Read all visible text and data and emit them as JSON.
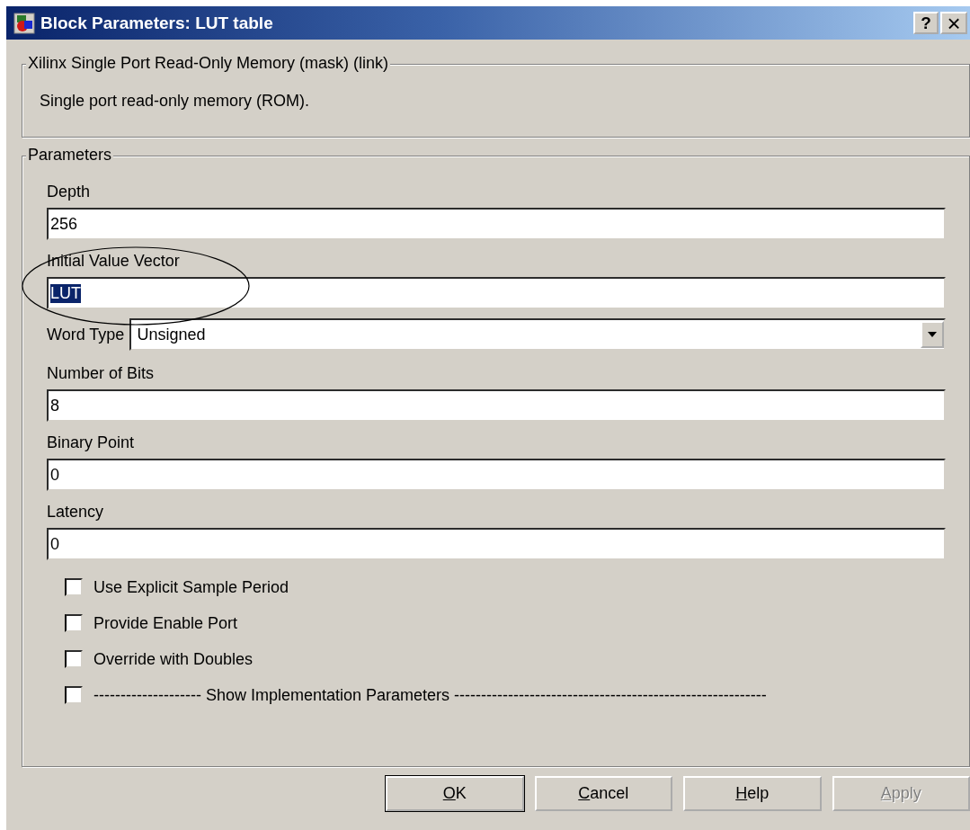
{
  "window": {
    "title": "Block Parameters: LUT table",
    "title_buttons": [
      {
        "kind": "help",
        "label": "?"
      },
      {
        "kind": "close",
        "label": "×"
      }
    ]
  },
  "description_group": {
    "title": "Xilinx Single Port Read-Only Memory (mask) (link)",
    "text": "Single port read-only memory (ROM)."
  },
  "parameters": {
    "title": "Parameters",
    "fields": [
      {
        "kind": "text",
        "label": "Depth",
        "value": "256",
        "text_selected": false
      },
      {
        "kind": "text",
        "label": "Initial Value Vector",
        "value": "LUT",
        "text_selected": true
      },
      {
        "kind": "dropdown",
        "label": "Word Type",
        "value": "Unsigned"
      },
      {
        "kind": "text",
        "label": "Number of Bits",
        "value": "8",
        "text_selected": false
      },
      {
        "kind": "text",
        "label": "Binary Point",
        "value": "0",
        "text_selected": false
      },
      {
        "kind": "text",
        "label": "Latency",
        "value": "0",
        "text_selected": false
      }
    ],
    "checkboxes": [
      {
        "label": "Use Explicit Sample Period",
        "checked": false
      },
      {
        "label": "Provide Enable Port",
        "checked": false
      },
      {
        "label": "Override with Doubles",
        "checked": false
      },
      {
        "label": "-------------------- Show Implementation Parameters ----------------------------------------------------------",
        "checked": false
      }
    ]
  },
  "buttons": [
    {
      "label": "OK",
      "default": true,
      "disabled": false
    },
    {
      "label": "Cancel",
      "default": false,
      "disabled": false
    },
    {
      "label": "Help",
      "default": false,
      "disabled": false
    },
    {
      "label": "Apply",
      "default": false,
      "disabled": true
    }
  ]
}
